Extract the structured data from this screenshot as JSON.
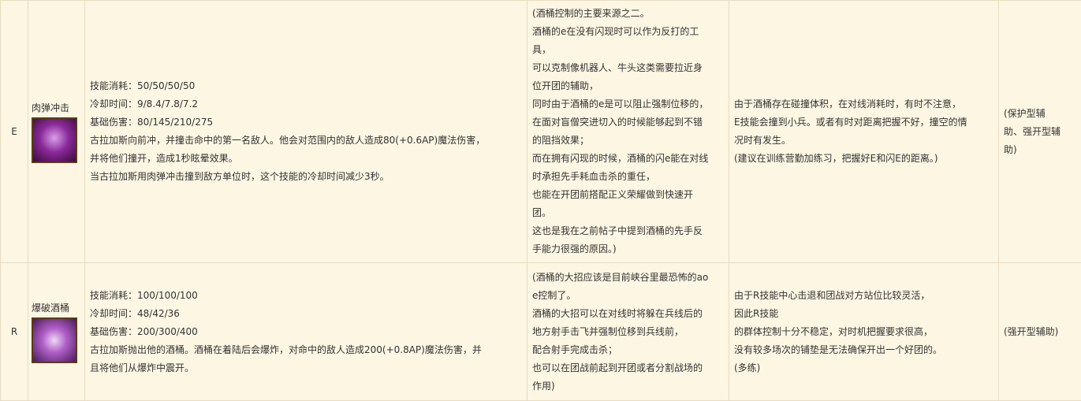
{
  "rows": [
    {
      "key": "E",
      "skill_name": "肉弹冲击",
      "icon": "skill-e-icon",
      "stats": [
        "技能消耗：50/50/50/50",
        "冷却时间：9/8.4/7.8/7.2",
        "基础伤害：80/145/210/275",
        "古拉加斯向前冲，并撞击命中的第一名敌人。他会对范围内的敌人造成80(+0.6AP)魔法伤害，",
        "并将他们撞开，造成1秒眩晕效果。",
        "当古拉加斯用肉弹冲击撞到敌方单位时，这个技能的冷却时间减少3秒。"
      ],
      "analysis": [
        "(酒桶控制的主要来源之二。",
        "酒桶的e在没有闪现时可以作为反打的工",
        "具，",
        "可以克制像机器人、牛头这类需要拉近身",
        "位开团的辅助，",
        "同时由于酒桶的e是可以阻止强制位移的，",
        "在面对盲僧突进切入的时候能够起到不错",
        "的阻挡效果；",
        "而在拥有闪现的时候，酒桶的闪e能在对线",
        "时承担先手耗血击杀的重任，",
        "也能在开团前搭配正义荣耀做到快速开",
        "团。",
        "这也是我在之前帖子中提到酒桶的先手反",
        "手能力很强的原因。)"
      ],
      "notes": [
        "由于酒桶存在碰撞体积，在对线消耗时，有时不注意，",
        "E技能会撞到小兵。或者有时对距离把握不好，撞空的情",
        "况时有发生。",
        "(建议在训练营勤加练习，把握好E和闪E的距离。)"
      ],
      "tags": [
        "(保护型辅",
        "助、强开型辅",
        "助)"
      ]
    },
    {
      "key": "R",
      "skill_name": "爆破酒桶",
      "icon": "skill-r-icon",
      "stats": [
        "技能消耗：100/100/100",
        "冷却时间：48/42/36",
        "基础伤害：200/300/400",
        "古拉加斯抛出他的酒桶。酒桶在着陆后会爆炸，对命中的敌人造成200(+0.8AP)魔法伤害，并",
        "且将他们从爆炸中震开。"
      ],
      "analysis": [
        "(酒桶的大招应该是目前峡谷里最恐怖的ao",
        "e控制了。",
        "酒桶的大招可以在对线时将躲在兵线后的",
        "地方射手击飞并强制位移到兵线前，",
        "配合射手完成击杀；",
        "也可以在团战前起到开团或者分割战场的",
        "作用)"
      ],
      "notes": [
        "由于R技能中心击退和团战对方站位比较灵活，",
        "因此R技能",
        "的群体控制十分不稳定，对时机把握要求很高，",
        "没有较多场次的铺垫是无法确保开出一个好团的。",
        "(多练)"
      ],
      "tags": [
        "(强开型辅助)"
      ]
    }
  ]
}
